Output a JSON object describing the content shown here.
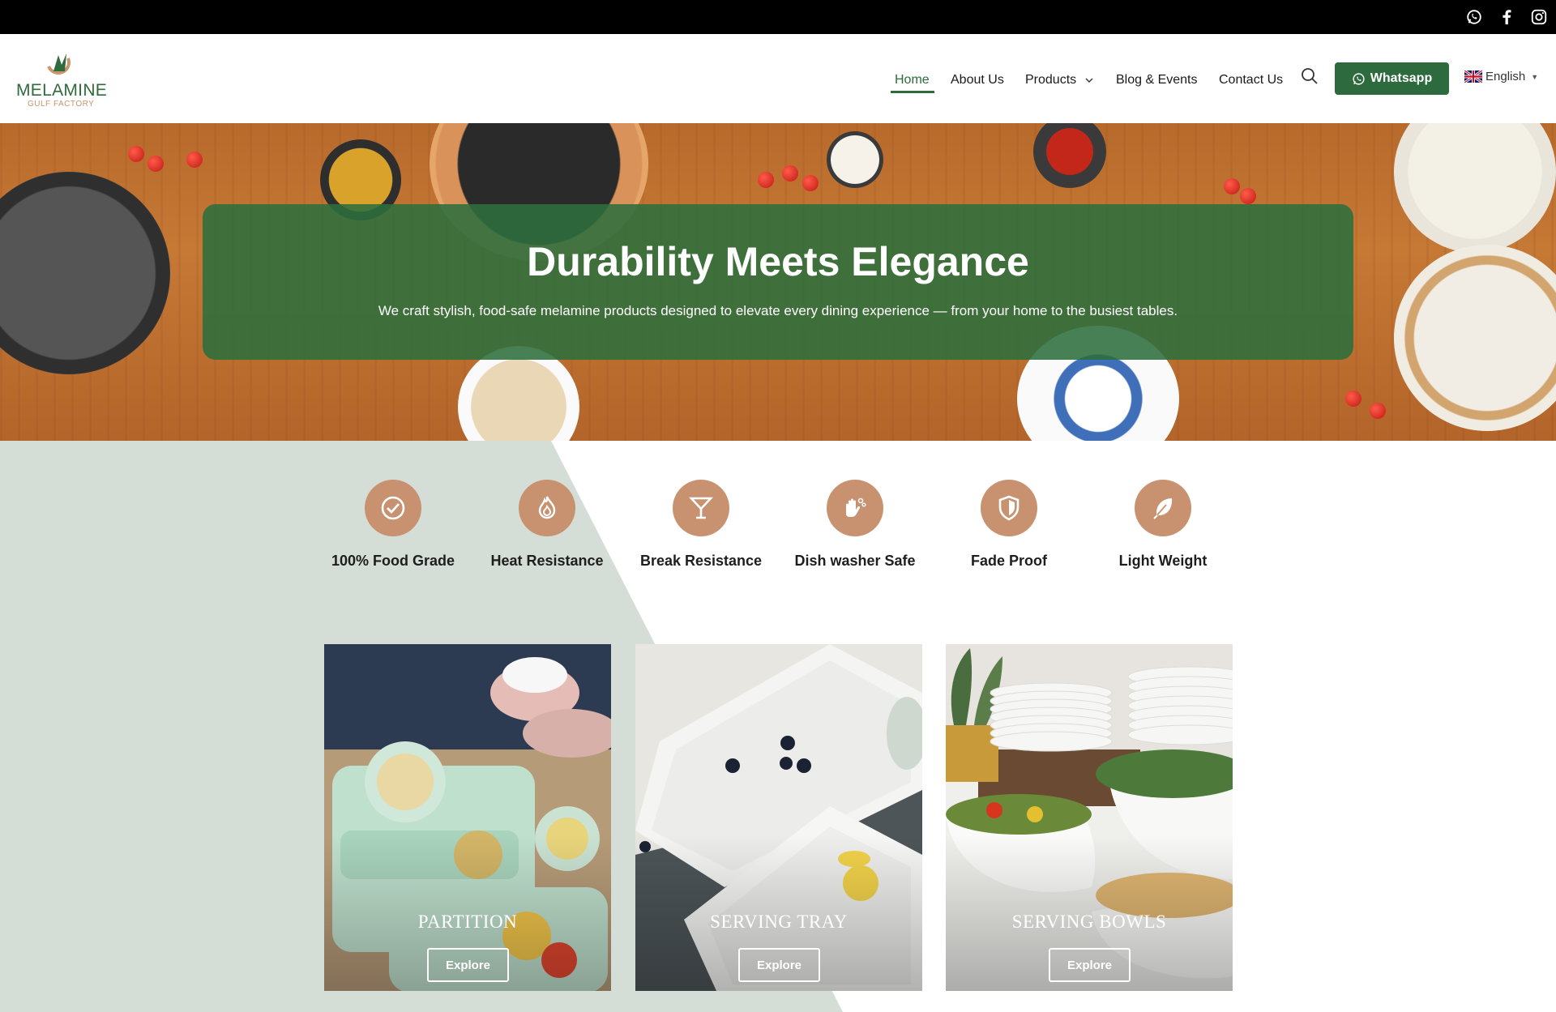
{
  "topbar": {
    "social": [
      "whatsapp-icon",
      "facebook-icon",
      "instagram-icon"
    ]
  },
  "header": {
    "logo": {
      "name": "MELAMINE",
      "sub": "GULF FACTORY"
    },
    "nav": {
      "home": "Home",
      "about": "About Us",
      "products": "Products",
      "blog": "Blog & Events",
      "contact": "Contact Us"
    },
    "whatsapp_label": "Whatsapp",
    "language": "English"
  },
  "hero": {
    "title": "Durability Meets Elegance",
    "subtitle": "We craft stylish, food-safe melamine products designed to elevate every dining experience — from your home to the busiest tables."
  },
  "features": [
    {
      "label": "100% Food Grade",
      "icon": "check-circle-icon"
    },
    {
      "label": "Heat Resistance",
      "icon": "flame-icon"
    },
    {
      "label": "Break Resistance",
      "icon": "cocktail-glass-icon"
    },
    {
      "label": "Dish washer Safe",
      "icon": "washing-hands-icon"
    },
    {
      "label": "Fade Proof",
      "icon": "shield-icon"
    },
    {
      "label": "Light Weight",
      "icon": "feather-icon"
    }
  ],
  "cards": [
    {
      "title": "PARTITION",
      "button": "Explore"
    },
    {
      "title": "SERVING TRAY",
      "button": "Explore"
    },
    {
      "title": "SERVING BOWLS",
      "button": "Explore"
    }
  ],
  "colors": {
    "brand_green": "#2d6a3d",
    "feature_accent": "#c89270",
    "section_tint": "#d4ddd6",
    "topbar": "#000000"
  }
}
